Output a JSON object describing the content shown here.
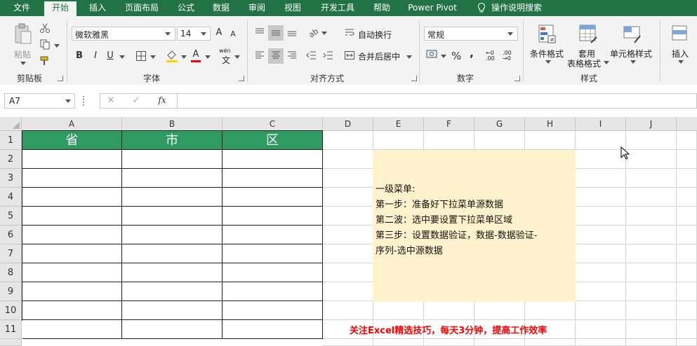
{
  "menu": {
    "items": [
      {
        "label": "文件",
        "active": false
      },
      {
        "label": "开始",
        "active": true
      },
      {
        "label": "插入",
        "active": false
      },
      {
        "label": "页面布局",
        "active": false
      },
      {
        "label": "公式",
        "active": false
      },
      {
        "label": "数据",
        "active": false
      },
      {
        "label": "审阅",
        "active": false
      },
      {
        "label": "视图",
        "active": false
      },
      {
        "label": "开发工具",
        "active": false
      },
      {
        "label": "帮助",
        "active": false
      },
      {
        "label": "Power Pivot",
        "active": false
      }
    ],
    "search_label": "操作说明搜索"
  },
  "ribbon": {
    "clipboard": {
      "paste": "粘贴",
      "group": "剪贴板"
    },
    "font": {
      "name": "微软雅黑",
      "size": "14",
      "bold": "B",
      "italic": "I",
      "underline": "U",
      "grow": "A",
      "shrink": "A",
      "font_color": "A",
      "phonetic": "wén",
      "phonetic_char": "文",
      "group": "字体"
    },
    "alignment": {
      "wrap": "自动换行",
      "merge": "合并后居中",
      "group": "对齐方式"
    },
    "number": {
      "format": "常规",
      "percent": "%",
      "comma": ",",
      "inc_decimal": "←0 .00",
      "dec_decimal": ".00 →0",
      "group": "数字"
    },
    "styles": {
      "conditional": "条件格式",
      "table_line1": "套用",
      "table_line2": "表格格式",
      "cell_styles": "单元格样式",
      "group": "样式"
    },
    "cells": {
      "insert": "插入"
    }
  },
  "formula_bar": {
    "name_box": "A7",
    "cancel": "✕",
    "enter": "✓",
    "fx": "fx",
    "value": ""
  },
  "sheet": {
    "columns": [
      "A",
      "B",
      "C",
      "D",
      "E",
      "F",
      "G",
      "H",
      "I",
      "J"
    ],
    "rows": [
      "1",
      "2",
      "3",
      "4",
      "5",
      "6",
      "7",
      "8",
      "9",
      "10",
      "11"
    ],
    "headers": [
      "省",
      "市",
      "区"
    ],
    "note_lines": [
      "一级菜单:",
      "第一步：准备好下拉菜单源数据",
      "第二波：选中要设置下拉菜单区域",
      "第三步：设置数据验证，数据-数据验证-",
      "序列-选中源数据"
    ],
    "footer_note": "关注Excel精选技巧，每天3分钟，提高工作效率"
  },
  "colors": {
    "brand": "#217346",
    "header_fill": "#2f9a61",
    "note_fill": "#fff2cc",
    "footer_text": "#ff0000"
  }
}
